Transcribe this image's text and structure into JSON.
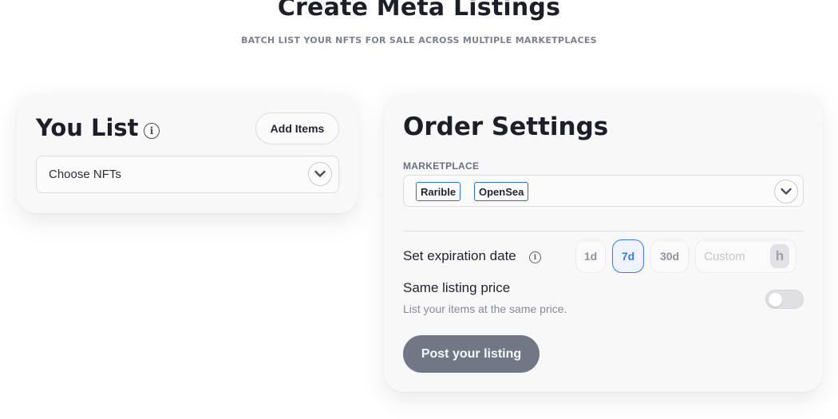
{
  "header": {
    "title": "Create Meta Listings",
    "subtitle": "BATCH LIST YOUR NFTS FOR SALE ACROSS MULTIPLE MARKETPLACES"
  },
  "you_list": {
    "title": "You List",
    "add_items_label": "Add Items",
    "choose_nfts_value": "Choose NFTs"
  },
  "order_settings": {
    "title": "Order Settings",
    "marketplace_label": "MARKETPLACE",
    "marketplaces": [
      "Rarible",
      "OpenSea"
    ],
    "expiration_label": "Set expiration date",
    "durations": [
      "1d",
      "7d",
      "30d"
    ],
    "selected_duration": "7d",
    "custom_placeholder": "Custom",
    "custom_value": "",
    "custom_unit": "h",
    "same_price_title": "Same listing price",
    "same_price_desc": "List your items at the same price.",
    "same_price_enabled": false,
    "post_button_label": "Post your listing"
  },
  "colors": {
    "accent": "#3b7be0",
    "button": "#727786",
    "card_bg": "#f8f8f9",
    "text": "#1c1f27"
  },
  "icons": [
    "info-icon",
    "chevron-down-icon"
  ]
}
